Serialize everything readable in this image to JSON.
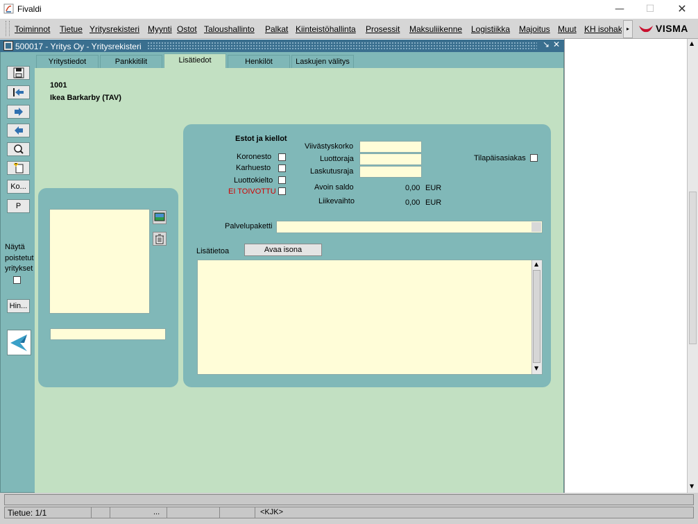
{
  "app": {
    "title": "Fivaldi",
    "brand": "VISMA"
  },
  "menu": [
    "Toiminnot",
    "Tietue",
    "Yritysrekisteri",
    "Myynti",
    "Ostot",
    "Taloushallinto",
    "Palkat",
    "Kiinteistöhallinta",
    "Prosessit",
    "Maksuliikenne",
    "Logistiikka",
    "Majoitus",
    "Muut",
    "KH isohak"
  ],
  "window": {
    "title": "500017 - Yritys Oy - Yritysrekisteri"
  },
  "tabs": [
    "Yritystiedot",
    "Pankkitilit",
    "Lisätiedot",
    "Henkilöt",
    "Laskujen välitys"
  ],
  "active_tab": "Lisätiedot",
  "toolbar": {
    "ko": "Ko...",
    "p": "P",
    "hin": "Hin..."
  },
  "show_deleted": {
    "label1": "Näytä",
    "label2": "poistetut",
    "label3": "yritykset"
  },
  "company": {
    "code": "1001",
    "name": "Ikea Barkarby (TAV)"
  },
  "restrictions": {
    "title": "Estot ja kiellot",
    "koronesto": "Koronesto",
    "karhuesto": "Karhuesto",
    "luottokielto": "Luottokielto",
    "ei_toivottu": "EI TOIVOTTU"
  },
  "fields": {
    "viivastyskorko": "Viivästyskorko",
    "luottoraja": "Luottoraja",
    "laskutusraja": "Laskutusraja",
    "avoin_saldo": "Avoin saldo",
    "avoin_saldo_value": "0,00",
    "liikevaihto": "Liikevaihto",
    "liikevaihto_value": "0,00",
    "currency": "EUR",
    "tilapaisasiakas": "Tilapäisasiakas",
    "palvelupaketti": "Palvelupaketti",
    "lisatietoa": "Lisätietoa",
    "avaa_isona": "Avaa isona"
  },
  "status": {
    "record": "Tietue: 1/1",
    "dots": "...",
    "kjk": "<KJK>"
  },
  "colors": {
    "teal": "#80b8b8",
    "green": "#c2e0c2",
    "field": "#fffdd8",
    "red": "#d00000",
    "visma_red": "#c8102e"
  }
}
